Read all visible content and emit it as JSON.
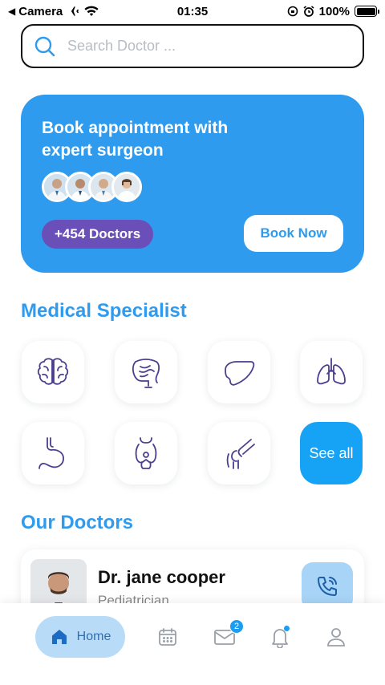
{
  "status_bar": {
    "carrier": "Camera",
    "time": "01:35",
    "battery": "100%"
  },
  "search": {
    "placeholder": "Search Doctor ..."
  },
  "banner": {
    "title": "Book appointment with expert surgeon",
    "doctors_count": "+454 Doctors",
    "button_label": "Book Now"
  },
  "specialist": {
    "title": "Medical Specialist",
    "items": [
      "brain-icon",
      "intestine-icon",
      "liver-icon",
      "lungs-icon",
      "stomach-icon",
      "thyroid-icon",
      "knee-icon"
    ],
    "see_all_label": "See all"
  },
  "doctors": {
    "title": "Our Doctors",
    "list": [
      {
        "name": "Dr. jane cooper",
        "specialty": "Pediatrician"
      }
    ]
  },
  "nav": {
    "home_label": "Home",
    "mail_badge": "2"
  },
  "colors": {
    "primary": "#2f9bef",
    "purple": "#6b4fb8",
    "icon_stroke": "#4b3f8f"
  }
}
